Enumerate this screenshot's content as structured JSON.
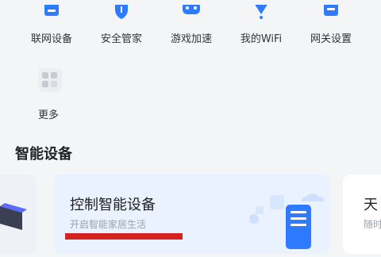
{
  "quick_actions": [
    {
      "label": "联网设备",
      "icon": "device-icon"
    },
    {
      "label": "安全管家",
      "icon": "shield-icon"
    },
    {
      "label": "游戏加速",
      "icon": "gamepad-icon"
    },
    {
      "label": "我的WiFi",
      "icon": "wifi-icon"
    },
    {
      "label": "网关设置",
      "icon": "settings-icon"
    }
  ],
  "more": {
    "label": "更多",
    "icon": "grid-icon"
  },
  "section": {
    "title": "智能设备"
  },
  "card_main": {
    "title": "控制智能设备",
    "subtitle": "开启智能家居生活"
  },
  "card_right": {
    "title": "天",
    "subtitle": "随时"
  },
  "colors": {
    "accent": "#2f7bff",
    "highlight": "#d4231f"
  }
}
